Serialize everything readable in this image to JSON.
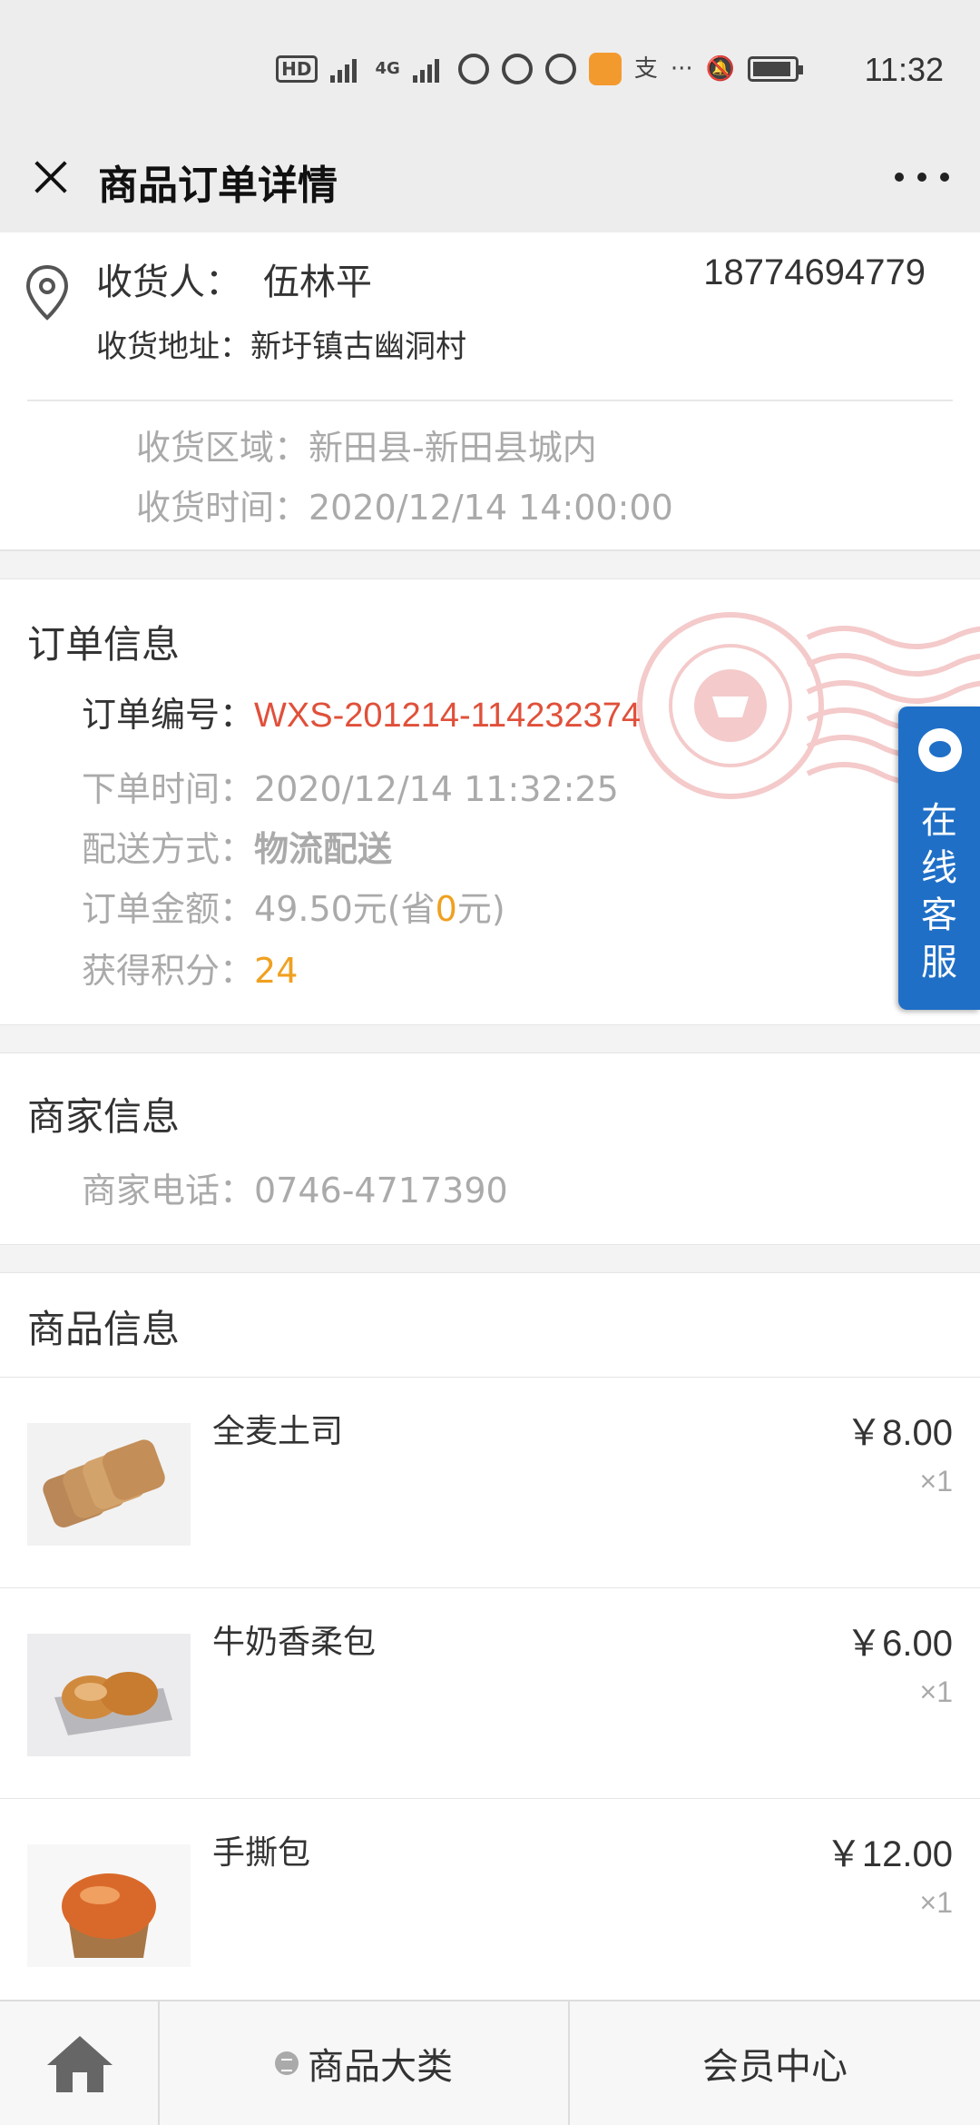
{
  "status_bar": {
    "time": "11:32",
    "hd_label": "HD",
    "network_label": "4G"
  },
  "header": {
    "title": "商品订单详情"
  },
  "address": {
    "receiver_label": "收货人：",
    "receiver_name": "伍林平",
    "phone": "18774694779",
    "address_line": "收货地址：新圩镇古幽洞村",
    "region_line": "收货区域：新田县-新田县城内",
    "time_line": "收货时间：2020/12/14 14:00:00"
  },
  "order": {
    "title": "订单信息",
    "order_no_label": "订单编号：",
    "order_no": "WXS-201214-114232374",
    "order_time_label": "下单时间：",
    "order_time": "2020/12/14 11:32:25",
    "delivery_label": "配送方式：",
    "delivery": "物流配送",
    "amount_label": "订单金额：",
    "amount": "49.50元(省",
    "saved": "0",
    "amount_suffix": "元)",
    "points_label": "获得积分：",
    "points": "24"
  },
  "service_tab": {
    "label_chars": [
      "在",
      "线",
      "客",
      "服"
    ]
  },
  "merchant": {
    "title": "商家信息",
    "phone_label": "商家电话：",
    "phone": "0746-4717390"
  },
  "goods": {
    "title": "商品信息",
    "items": [
      {
        "name": "全麦土司",
        "price": "￥8.00",
        "qty": "×1"
      },
      {
        "name": "牛奶香柔包",
        "price": "￥6.00",
        "qty": "×1"
      },
      {
        "name": "手撕包",
        "price": "￥12.00",
        "qty": "×1"
      }
    ]
  },
  "bottom_nav": {
    "category_label": "商品大类",
    "member_label": "会员中心"
  }
}
